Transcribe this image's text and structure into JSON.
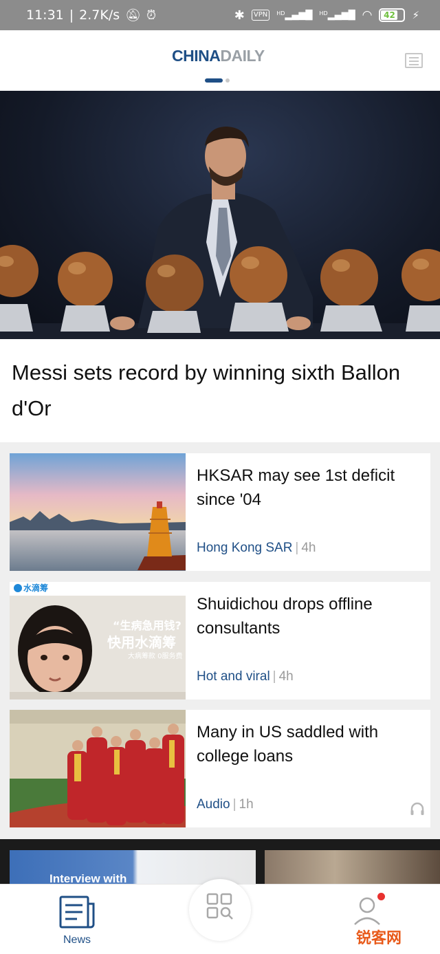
{
  "status_bar": {
    "time": "11:31",
    "speed": "2.7K/s",
    "vpn": "VPN",
    "hd": "HD",
    "battery": "42"
  },
  "header": {
    "logo_part1": "CHINA",
    "logo_part2": "DAILY"
  },
  "hero": {
    "title": "Messi sets record by winning sixth Ballon d'Or"
  },
  "feed": [
    {
      "title": "HKSAR may see 1st deficit since '04",
      "category": "Hong Kong SAR",
      "time": "4h"
    },
    {
      "title": "Shuidichou drops offline consultants",
      "category": "Hot and viral",
      "time": "4h",
      "thumb_text": {
        "brand": "水滴筹",
        "line1": "“生病急用钱?",
        "line2": "快用水滴筹",
        "line3": "大病筹款 0服务费"
      }
    },
    {
      "title": "Many in US saddled with college loans",
      "category": "Audio",
      "time": "1h"
    }
  ],
  "strip": {
    "caption": "Interview with"
  },
  "bottom_nav": {
    "news_label": "News",
    "watermark": "锐客网"
  },
  "colors": {
    "brand_blue": "#1f4f86",
    "status_bar": "#8c8c8c",
    "feed_bg": "#efefef",
    "badge_red": "#e8312f"
  }
}
